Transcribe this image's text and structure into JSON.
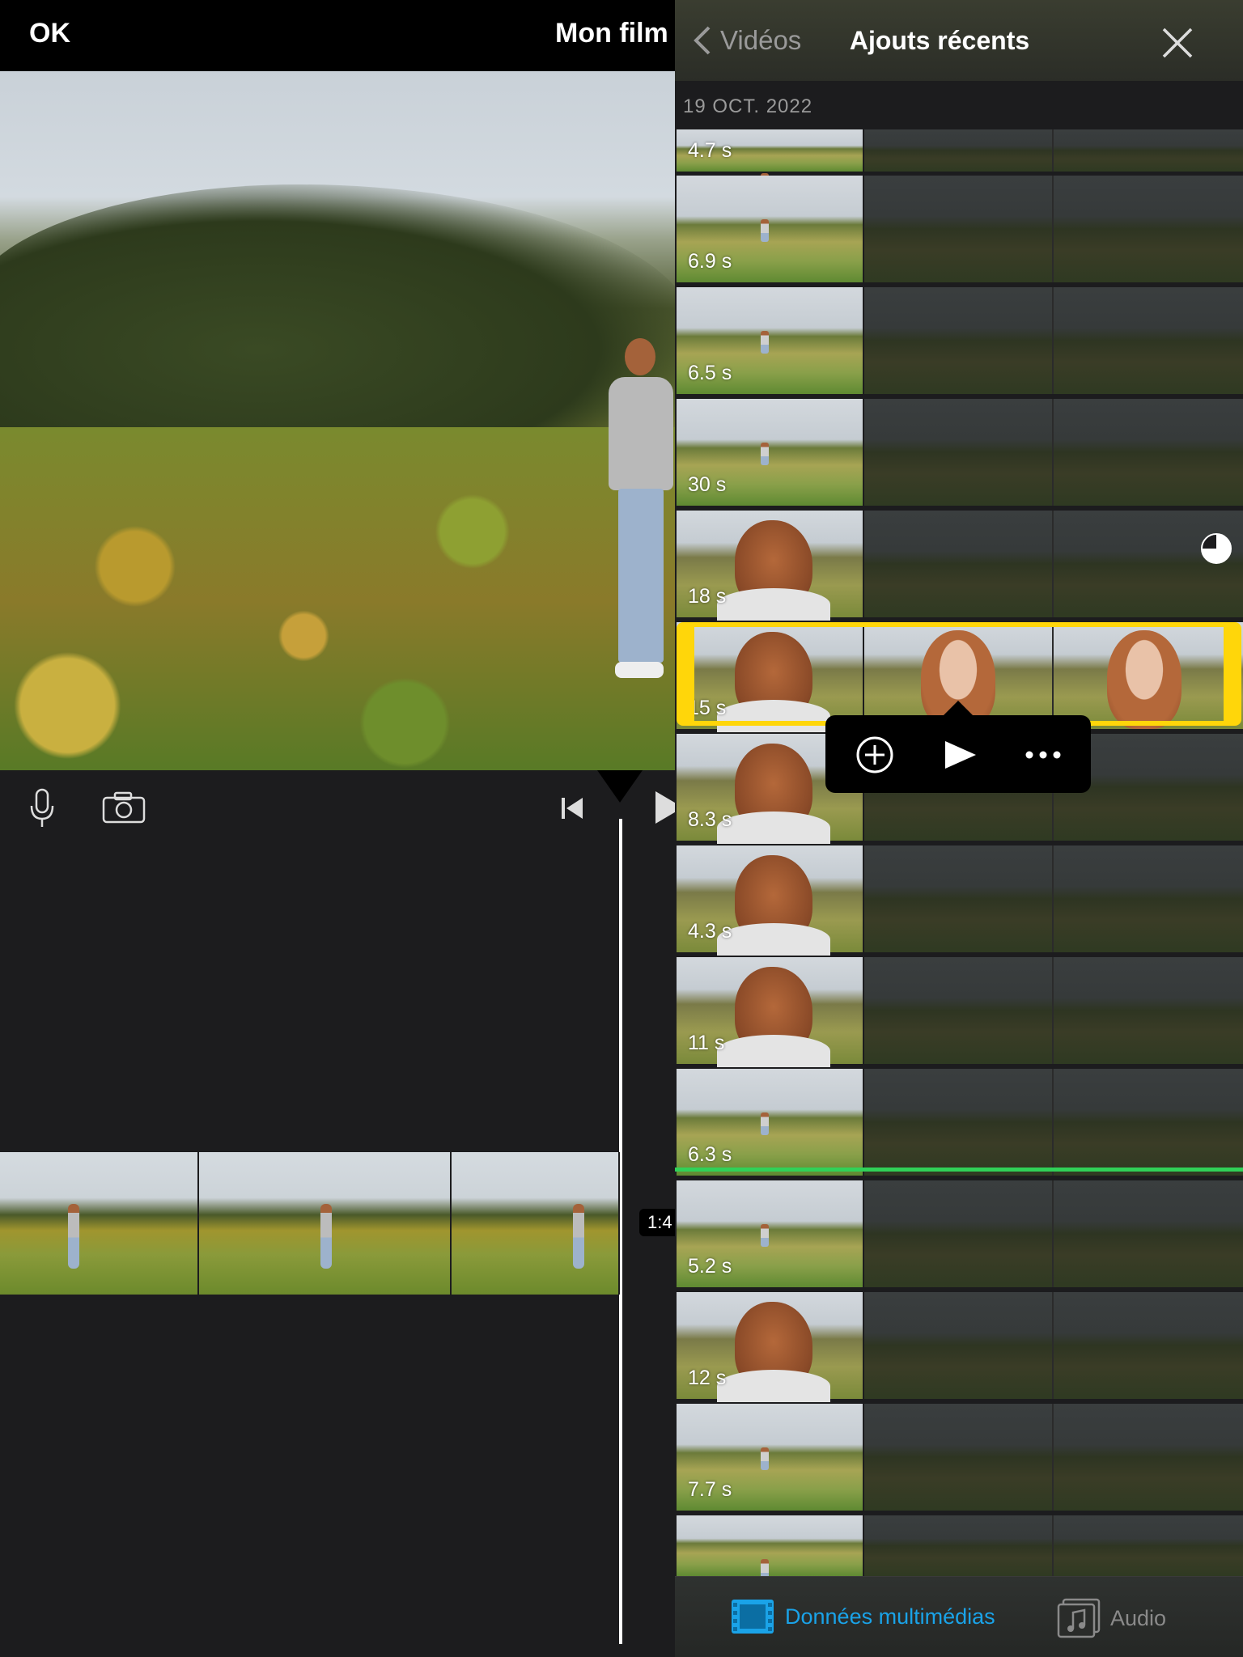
{
  "editor": {
    "done_label": "OK",
    "movie_title": "Mon film",
    "timecode": "1:4"
  },
  "browser": {
    "back_label": "Vidéos",
    "title": "Ajouts récents",
    "date_header": "19 OCT. 2022",
    "clips": [
      {
        "duration": "4.7 s",
        "style": "landscape"
      },
      {
        "duration": "6.9 s",
        "style": "landscape"
      },
      {
        "duration": "6.5 s",
        "style": "landscape"
      },
      {
        "duration": "30 s",
        "style": "landscape"
      },
      {
        "duration": "18 s",
        "style": "portrait"
      },
      {
        "duration": "15 s",
        "style": "selected"
      },
      {
        "duration": "8.3 s",
        "style": "portrait"
      },
      {
        "duration": "4.3 s",
        "style": "portrait"
      },
      {
        "duration": "11 s",
        "style": "portrait"
      },
      {
        "duration": "6.3 s",
        "style": "landscape"
      },
      {
        "duration": "5.2 s",
        "style": "landscape"
      },
      {
        "duration": "12 s",
        "style": "portrait"
      },
      {
        "duration": "7.7 s",
        "style": "landscape"
      },
      {
        "duration": "",
        "style": "landscape"
      }
    ],
    "popup": {
      "add_icon": "plus-circle-icon",
      "play_icon": "play-icon",
      "more_icon": "ellipsis-icon"
    },
    "tabs": {
      "media_label": "Données multimédias",
      "audio_label": "Audio"
    },
    "colors": {
      "selection": "#ffd60a",
      "active_tab": "#1aa3e8",
      "used_marker": "#30d158"
    }
  }
}
